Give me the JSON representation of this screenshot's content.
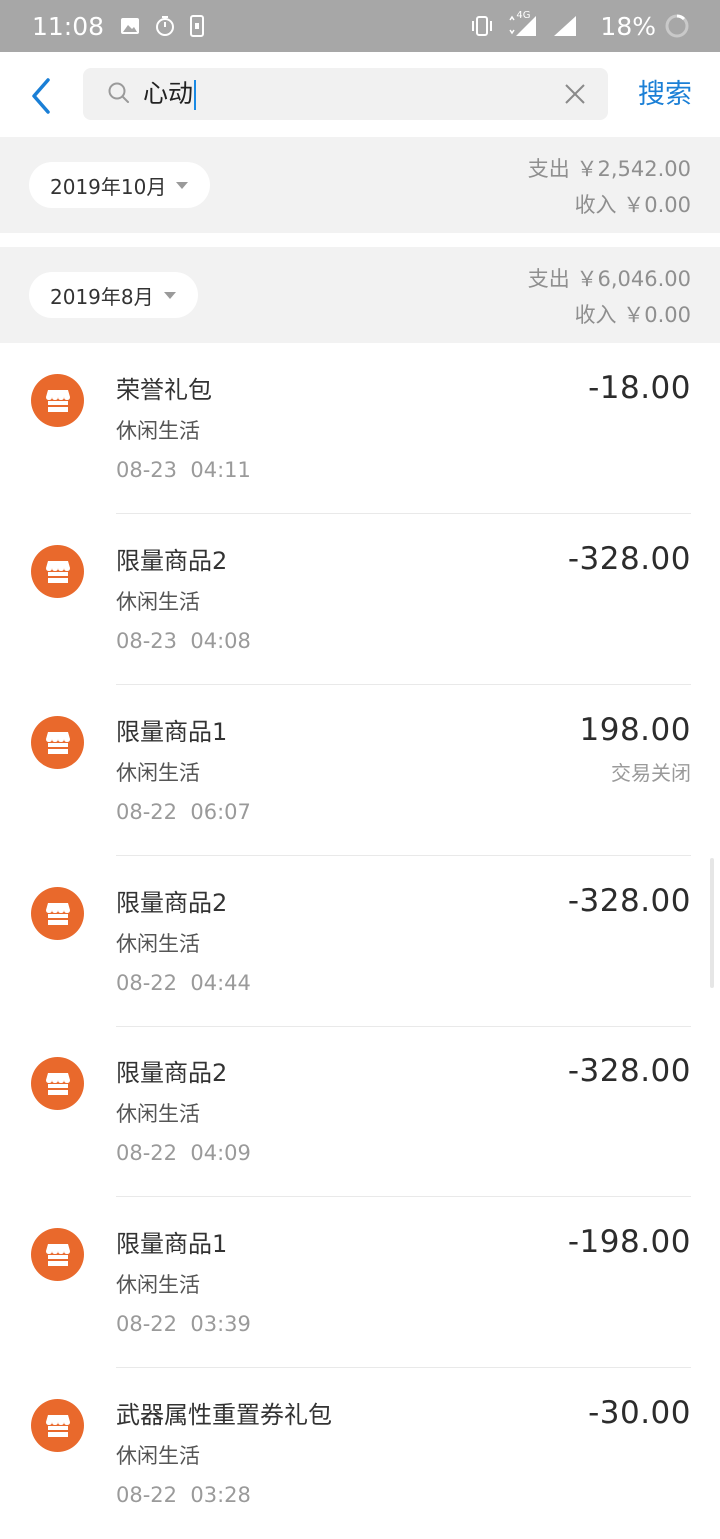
{
  "status_bar": {
    "time": "11:08",
    "network": "4G",
    "battery": "18%"
  },
  "search": {
    "value": "心动",
    "submit_label": "搜索"
  },
  "months": [
    {
      "label": "2019年10月",
      "expense": "支出 ￥2,542.00",
      "income": "收入 ￥0.00"
    },
    {
      "label": "2019年8月",
      "expense": "支出 ￥6,046.00",
      "income": "收入 ￥0.00"
    }
  ],
  "transactions": [
    {
      "title": "荣誉礼包",
      "category": "休闲生活",
      "time": "08-23  04:11",
      "amount": "-18.00",
      "note": ""
    },
    {
      "title": "限量商品2",
      "category": "休闲生活",
      "time": "08-23  04:08",
      "amount": "-328.00",
      "note": ""
    },
    {
      "title": "限量商品1",
      "category": "休闲生活",
      "time": "08-22  06:07",
      "amount": "198.00",
      "note": "交易关闭"
    },
    {
      "title": "限量商品2",
      "category": "休闲生活",
      "time": "08-22  04:44",
      "amount": "-328.00",
      "note": ""
    },
    {
      "title": "限量商品2",
      "category": "休闲生活",
      "time": "08-22  04:09",
      "amount": "-328.00",
      "note": ""
    },
    {
      "title": "限量商品1",
      "category": "休闲生活",
      "time": "08-22  03:39",
      "amount": "-198.00",
      "note": ""
    },
    {
      "title": "武器属性重置券礼包",
      "category": "休闲生活",
      "time": "08-22  03:28",
      "amount": "-30.00",
      "note": ""
    }
  ],
  "icons": {
    "back": "chevron-left-icon",
    "search": "search-icon",
    "clear": "close-icon",
    "merchant": "shop-icon"
  },
  "colors": {
    "accent": "#1a7fd6",
    "merchant_icon": "#e9692c",
    "status_bar": "#a7a7a7"
  }
}
